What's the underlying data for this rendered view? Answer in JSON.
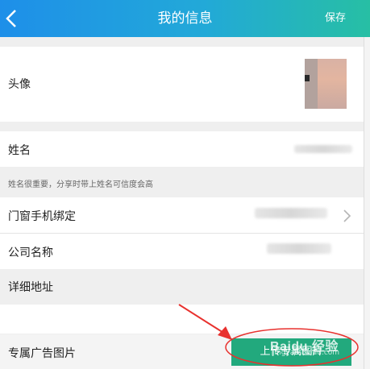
{
  "header": {
    "title": "我的信息",
    "save_label": "保存"
  },
  "profile": {
    "avatar_label": "头像",
    "name_label": "姓名",
    "name_hint": "姓名很重要，分享时带上姓名可信度会高",
    "phone_label": "门窗手机绑定",
    "company_label": "公司名称",
    "address_label": "详细地址",
    "ad_image_label": "专属广告图片",
    "upload_button_label": "上传专属图片"
  },
  "watermark": {
    "main": "Baidu 经验",
    "sub": "jingyan.baidu.com"
  },
  "colors": {
    "header_gradient_start": "#1e8fe9",
    "header_gradient_end": "#27bfa4",
    "upload_button": "#22a97d",
    "annotation": "#e8312e"
  }
}
